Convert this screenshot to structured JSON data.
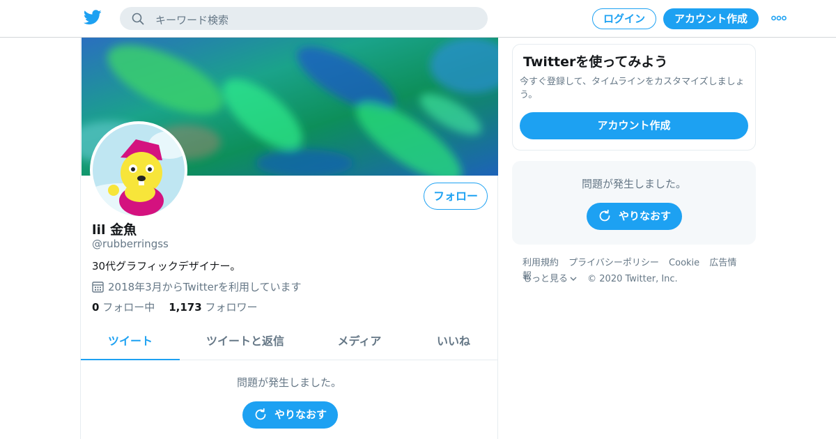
{
  "header": {
    "logo_icon": "twitter-bird-icon",
    "search_placeholder": "キーワード検索",
    "login_label": "ログイン",
    "signup_label": "アカウント作成",
    "more_icon": "more-dots-icon"
  },
  "profile": {
    "display_name": "lil 金魚",
    "handle": "@rubberringss",
    "bio": "30代グラフィックデザイナー。",
    "joined": "2018年3月からTwitterを利用しています",
    "following_count": "0",
    "following_label": "フォロー中",
    "followers_count": "1,173",
    "followers_label": "フォロワー",
    "follow_label": "フォロー"
  },
  "tabs": [
    {
      "label": "ツイート",
      "active": true
    },
    {
      "label": "ツイートと返信",
      "active": false
    },
    {
      "label": "メディア",
      "active": false
    },
    {
      "label": "いいね",
      "active": false
    }
  ],
  "timeline": {
    "error_text": "問題が発生しました。",
    "retry_label": "やりなおす"
  },
  "sidebar": {
    "signup_title": "Twitterを使ってみよう",
    "signup_desc": "今すぐ登録して、タイムラインをカスタマイズしましょう。",
    "signup_button": "アカウント作成",
    "error_text": "問題が発生しました。",
    "retry_label": "やりなおす"
  },
  "footer": {
    "links": [
      "利用規約",
      "プライバシーポリシー",
      "Cookie",
      "広告情報"
    ],
    "more_label": "もっと見る",
    "copyright": "© 2020 Twitter, Inc."
  },
  "colors": {
    "accent": "#1da1f2",
    "secondary_text": "#657786",
    "primary_text": "#14171a",
    "border": "#e6ecf0"
  }
}
